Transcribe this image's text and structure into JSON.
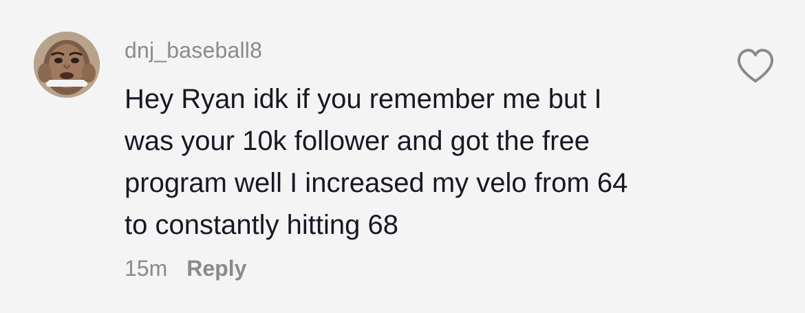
{
  "comment": {
    "avatar_icon": "user-avatar",
    "username": "dnj_baseball8",
    "text": "Hey Ryan idk if you remember me but I\nwas your 10k follower and got the free\nprogram well I increased my velo from 64\nto constantly hitting 68",
    "time": "15m",
    "reply_label": "Reply",
    "like_icon": "heart-outline-icon"
  },
  "colors": {
    "background": "#f4f4f4",
    "text": "#161823",
    "muted": "#8a8a8a"
  }
}
